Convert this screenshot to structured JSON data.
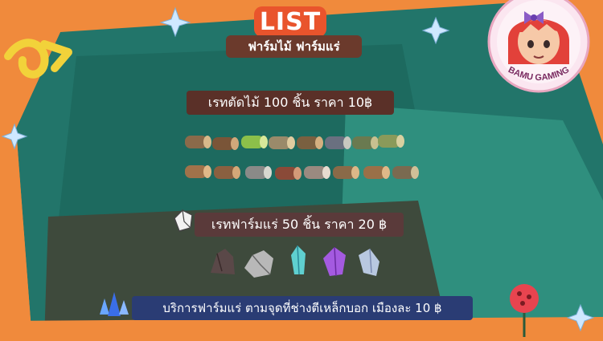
{
  "header": {
    "title": "LIST",
    "subtitle": "ฟาร์มไม้ ฟาร์มแร่"
  },
  "wood_section": {
    "rate_label": "เรทตัดไม้  100 ชิ้น  ราคา 10฿",
    "item_icons": [
      "log-icon",
      "log-icon",
      "bamboo-log-icon",
      "log-icon",
      "log-icon",
      "log-icon",
      "log-icon",
      "log-icon",
      "log-icon",
      "log-icon",
      "log-icon",
      "log-icon",
      "log-icon",
      "log-icon",
      "log-icon",
      "log-icon"
    ]
  },
  "ore_section": {
    "rate_label": "เรทฟาร์มแร่ 50 ชิ้น ราคา 20 ฿",
    "item_icons": [
      "iron-chunk-icon",
      "white-iron-chunk-icon",
      "crystal-chunk-icon",
      "electro-crystal-icon",
      "starsilver-icon"
    ]
  },
  "service": {
    "label": "บริการฟาร์มแร่ ตามจุดที่ช่างตีเหล็กบอก เมืองละ 10 ฿"
  },
  "badge": {
    "text": "BAMU GAMING"
  },
  "colors": {
    "background_orange": "#f08a3c",
    "teal_dark": "#1f6e62",
    "teal_mid": "#2e8c7c",
    "olive_dark": "#3f4a3c",
    "title_red": "#e9542c",
    "pill_brown": "#5a3028",
    "pill_navy": "#2a3c74"
  }
}
